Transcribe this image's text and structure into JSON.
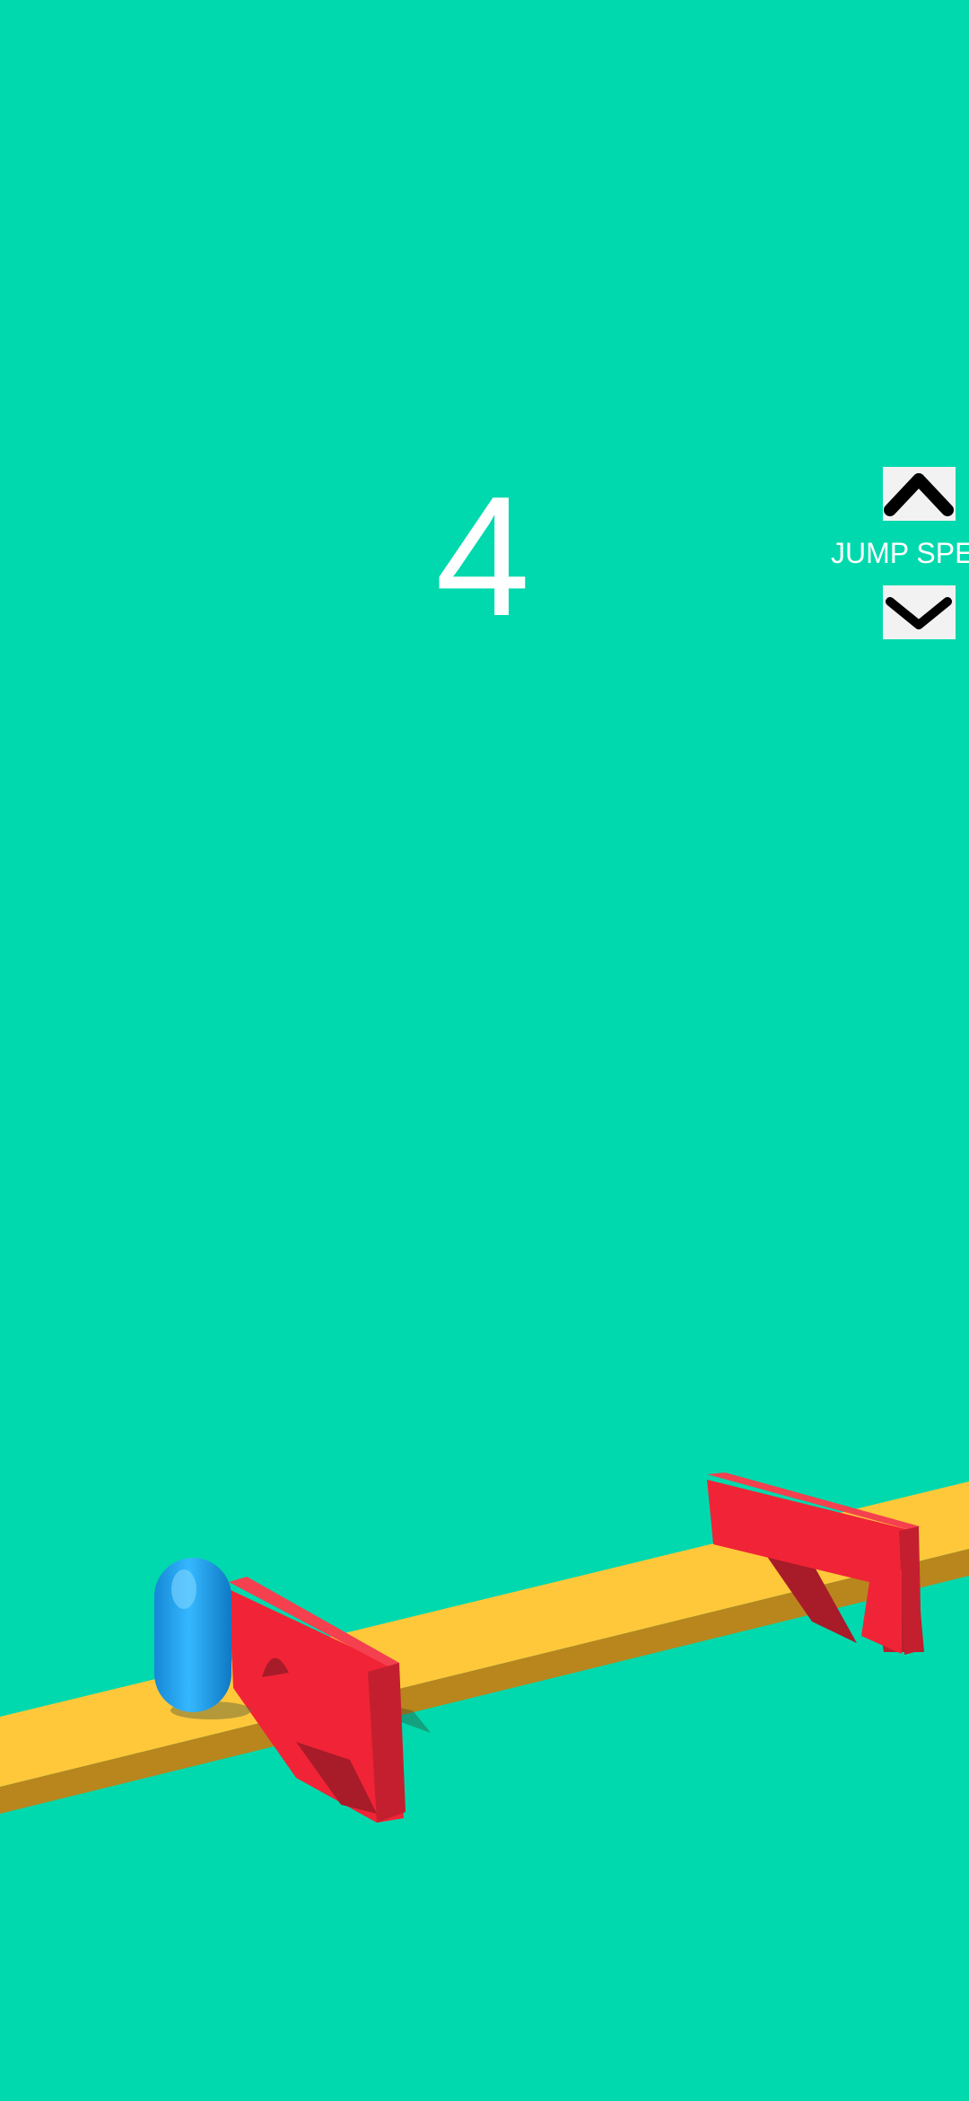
{
  "hud": {
    "score": "4",
    "jump_speed_label": "JUMP SPE",
    "increase_icon": "chevron-up-icon",
    "decrease_icon": "chevron-down-icon"
  },
  "colors": {
    "background": "#00d9ad",
    "track_top": "#ffc83a",
    "track_side": "#b8861d",
    "barrier": "#f02436",
    "player": "#1ea4f0"
  }
}
